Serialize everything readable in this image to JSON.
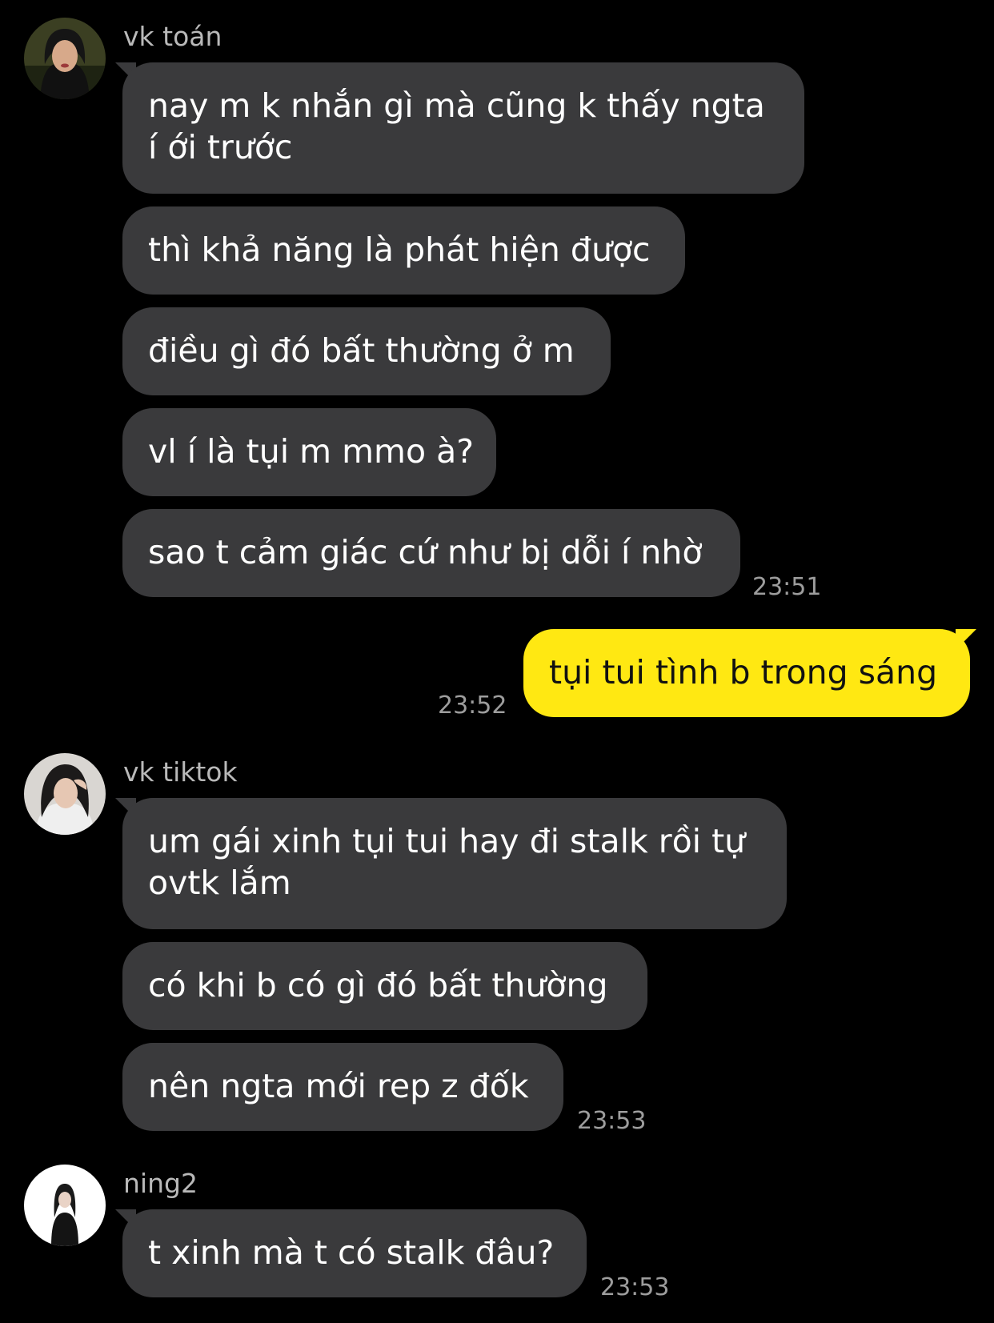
{
  "colors": {
    "background": "#000000",
    "incoming_bubble": "#3a3a3c",
    "outgoing_bubble": "#ffe812",
    "sender_name": "#b9b9b9",
    "timestamp": "#9d9d9d"
  },
  "groups": [
    {
      "sender": "vk toán",
      "avatar_icon": "profile-photo-icon",
      "messages": [
        "nay m k nhắn gì mà cũng k thấy ngta\ní ới trước",
        "thì khả năng là phát hiện được",
        "điều gì đó bất thường ở m",
        "vl í là tụi m mmo à?",
        "sao t cảm giác cứ như bị dỗi í nhờ"
      ],
      "time": "23:51"
    },
    {
      "sender": "me",
      "messages": [
        "tụi tui tình b trong sáng"
      ],
      "time": "23:52"
    },
    {
      "sender": "vk tiktok",
      "avatar_icon": "profile-photo-icon",
      "messages": [
        "um gái xinh tụi tui hay đi stalk rồi tự\novtk lắm",
        "có khi b có gì đó bất thường",
        "nên ngta mới rep z đốk"
      ],
      "time": "23:53"
    },
    {
      "sender": "ning2",
      "avatar_icon": "profile-photo-icon",
      "messages": [
        "t xinh mà t có stalk đâu?"
      ],
      "time": "23:53"
    }
  ]
}
